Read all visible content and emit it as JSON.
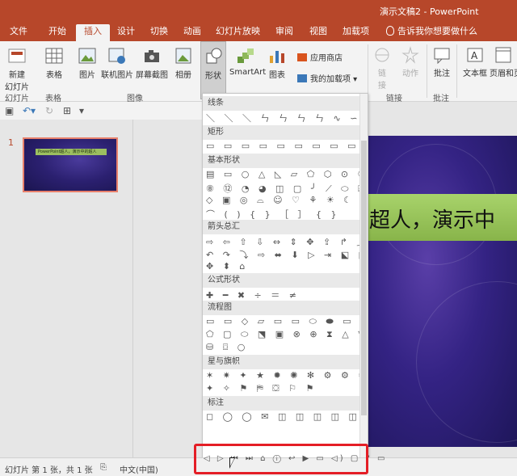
{
  "window": {
    "title": "演示文稿2 - PowerPoint"
  },
  "tabs": [
    {
      "label": "文件"
    },
    {
      "label": "开始"
    },
    {
      "label": "插入"
    },
    {
      "label": "设计"
    },
    {
      "label": "切换"
    },
    {
      "label": "动画"
    },
    {
      "label": "幻灯片放映"
    },
    {
      "label": "审阅"
    },
    {
      "label": "视图"
    },
    {
      "label": "加载项"
    }
  ],
  "tellme": "告诉我你想要做什么",
  "ribbon": {
    "new_slide": "新建\n幻灯片",
    "table": "表格",
    "picture": "图片",
    "online_picture": "联机图片",
    "screenshot": "屏幕截图",
    "album": "相册",
    "shapes": "形状",
    "smartart": "SmartArt",
    "chart": "图表",
    "store": "应用商店",
    "my_addins": "我的加载项",
    "link": "链\n接",
    "action": "动作",
    "comment": "批注",
    "textbox": "文本框",
    "header_footer": "页眉和页",
    "groups": {
      "slides": "幻灯片",
      "tables": "表格",
      "images": "图像",
      "links": "链接",
      "comments": "批注"
    }
  },
  "thumb": {
    "number": "1",
    "caption": "PowerPoint超人，演示中的超人"
  },
  "slide": {
    "headline": "超人，演示中"
  },
  "gallery": {
    "sections": [
      {
        "title": "线条",
        "rows": [
          "＼ ＼ ＼ ㄣ ㄣ ㄣ ㄣ ∿ ∽ ↗"
        ]
      },
      {
        "title": "矩形",
        "rows": [
          "▭ ▭ ▭ ▭ ▭ ▭ ▭ ▭ ▭"
        ]
      },
      {
        "title": "基本形状",
        "rows": [
          "▤ ▭ ○ △ ◺ ▱ ⬠ ⬡ ⊙ ⑩",
          "⑧ ⑫ ◔ ◕ ◫ ▢ ╯ ⟋ ⬭ ⌸",
          "◇ ▣ ◎ ⌓ ☺ ♡ ⚘ ☀ ☾ ☁",
          "⌒ ( ) { } ［ ］ { }"
        ]
      },
      {
        "title": "箭头总汇",
        "rows": [
          "⇨ ⇦ ⇧ ⇩ ⇔ ⇕ ✥ ⇪ ↱ ⤴ ↩",
          "↶ ↷ ⤵ ⇨ ⬌ ⬇ ▷ ⇥ ⬕ ⬔ ⬓",
          "✥ ⬍ ⌂"
        ]
      },
      {
        "title": "公式形状",
        "rows": [
          "✚ ━ ✖ ÷ ＝ ≠"
        ]
      },
      {
        "title": "流程图",
        "rows": [
          "▭ ▭ ◇ ▱ ▭ ▭ ⬭ ⬬ ▭ ⬯",
          "⬠ ▢ ⬭ ⬔ ▣ ⊗ ⊕ ⧗ △ ▽ ▢",
          "⛁ ⌼ ○"
        ]
      },
      {
        "title": "星与旗帜",
        "rows": [
          "✶ ✷ ✦ ★ ✹ ✺ ✻ ⚙ ⚙ ⚙ ⚙",
          "✦ ✧ ⚑ ⛿ ⛋ ⚐ ⚑"
        ]
      },
      {
        "title": "标注",
        "rows": [
          "◻ ◯ ◯ ✉ ◫ ◫ ◫ ◫ ◫ ◫ ◫"
        ]
      }
    ],
    "action_buttons": "◁ ▷ ⏮ ⏭ ⌂ ⓘ ↩ ▶ ▭ ◁) ▢ ? ▭"
  },
  "status": {
    "slide_info": "幻灯片 第 1 张，共 1 张",
    "language": "中文(中国)"
  },
  "colors": {
    "accent": "#b7472a",
    "highlight": "#e41e26"
  }
}
